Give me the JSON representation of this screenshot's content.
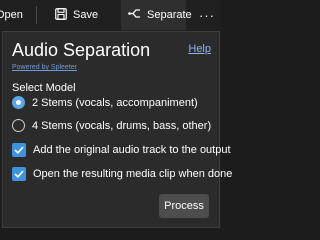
{
  "toolbar": {
    "open_label": "Open",
    "save_label": "Save",
    "separate_label": "Separate",
    "more_label": "···"
  },
  "dialog": {
    "title": "Audio Separation",
    "help_link": "Help",
    "powered_by": "Powered by Spleeter",
    "model_label": "Select Model",
    "options": [
      {
        "label": "2 Stems (vocals, accompaniment)",
        "selected": true
      },
      {
        "label": "4 Stems (vocals, drums, bass, other)",
        "selected": false
      }
    ],
    "checkboxes": [
      {
        "label": "Add the original audio track to the output",
        "checked": true
      },
      {
        "label": "Open the resulting media clip when done",
        "checked": true
      }
    ],
    "process_label": "Process"
  },
  "colors": {
    "accent": "#3f93dd",
    "link": "#8ab4f8",
    "panel_bg": "#2b2b2b"
  }
}
